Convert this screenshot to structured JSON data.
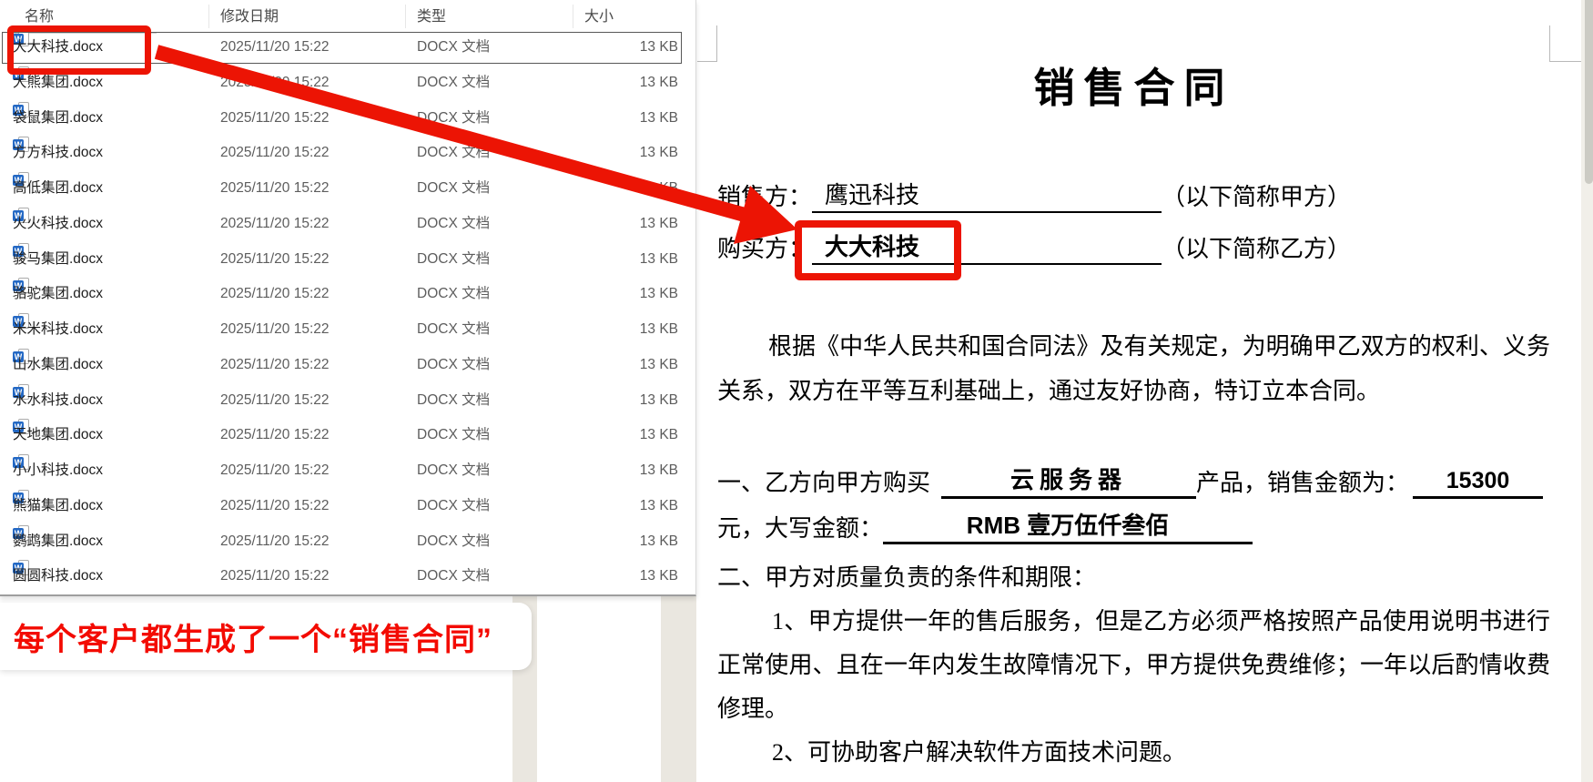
{
  "colors": {
    "annotation_red": "#ec1404",
    "callout_red": "#f30b02",
    "word_icon_blue": "#2368c4"
  },
  "explorer": {
    "columns": [
      "名称",
      "修改日期",
      "类型",
      "大小"
    ],
    "selected_index": 0,
    "file_icon": "word-docx-icon",
    "files": [
      {
        "name": "大大科技.docx",
        "date": "2025/11/20 15:22",
        "type": "DOCX 文档",
        "size": "13 KB"
      },
      {
        "name": "大熊集团.docx",
        "date": "2025/11/20 15:22",
        "type": "DOCX 文档",
        "size": "13 KB"
      },
      {
        "name": "袋鼠集团.docx",
        "date": "2025/11/20 15:22",
        "type": "DOCX 文档",
        "size": "13 KB"
      },
      {
        "name": "方方科技.docx",
        "date": "2025/11/20 15:22",
        "type": "DOCX 文档",
        "size": "13 KB"
      },
      {
        "name": "高低集团.docx",
        "date": "2025/11/20 15:22",
        "type": "DOCX 文档",
        "size": "13 KB"
      },
      {
        "name": "火火科技.docx",
        "date": "2025/11/20 15:22",
        "type": "DOCX 文档",
        "size": "13 KB"
      },
      {
        "name": "骏马集团.docx",
        "date": "2025/11/20 15:22",
        "type": "DOCX 文档",
        "size": "13 KB"
      },
      {
        "name": "骆驼集团.docx",
        "date": "2025/11/20 15:22",
        "type": "DOCX 文档",
        "size": "13 KB"
      },
      {
        "name": "米米科技.docx",
        "date": "2025/11/20 15:22",
        "type": "DOCX 文档",
        "size": "13 KB"
      },
      {
        "name": "山水集团.docx",
        "date": "2025/11/20 15:22",
        "type": "DOCX 文档",
        "size": "13 KB"
      },
      {
        "name": "水水科技.docx",
        "date": "2025/11/20 15:22",
        "type": "DOCX 文档",
        "size": "13 KB"
      },
      {
        "name": "天地集团.docx",
        "date": "2025/11/20 15:22",
        "type": "DOCX 文档",
        "size": "13 KB"
      },
      {
        "name": "小小科技.docx",
        "date": "2025/11/20 15:22",
        "type": "DOCX 文档",
        "size": "13 KB"
      },
      {
        "name": "熊猫集团.docx",
        "date": "2025/11/20 15:22",
        "type": "DOCX 文档",
        "size": "13 KB"
      },
      {
        "name": "鹦鹉集团.docx",
        "date": "2025/11/20 15:22",
        "type": "DOCX 文档",
        "size": "13 KB"
      },
      {
        "name": "圆圆科技.docx",
        "date": "2025/11/20 15:22",
        "type": "DOCX 文档",
        "size": "13 KB"
      }
    ]
  },
  "document": {
    "title": "销售合同",
    "seller_label": "销售方：",
    "seller_value": "鹰迅科技",
    "seller_suffix": "（以下简称甲方）",
    "buyer_label": "购买方：",
    "buyer_value": "大大科技",
    "buyer_suffix": "（以下简称乙方）",
    "para1_line1": "根据《中华人民共和国合同法》及有关规定，为明确甲乙双方的权利、义务",
    "para1_line2": "关系，双方在平等互利基础上，通过友好协商，特订立本合同。",
    "clause1_prefix": "一、乙方向甲方购买",
    "clause1_product": "云服务器",
    "clause1_mid": "产品，销售金额为：",
    "clause1_amount": "15300",
    "clause1b_prefix": "元，大写金额：",
    "clause1b_amount": "RMB 壹万伍仟叁佰",
    "clause2_heading": "二、甲方对质量负责的条件和期限：",
    "clause2_item1_line1": "1、甲方提供一年的售后服务，但是乙方必须严格按照产品使用说明书进行",
    "clause2_item1_line2": "正常使用、且在一年内发生故障情况下，甲方提供免费维修；一年以后酌情收费",
    "clause2_item1_line3": "修理。",
    "clause2_item2": "2、可协助客户解决软件方面技术问题。"
  },
  "annotation": {
    "callout_text": "每个客户都生成了一个“销售合同”"
  }
}
